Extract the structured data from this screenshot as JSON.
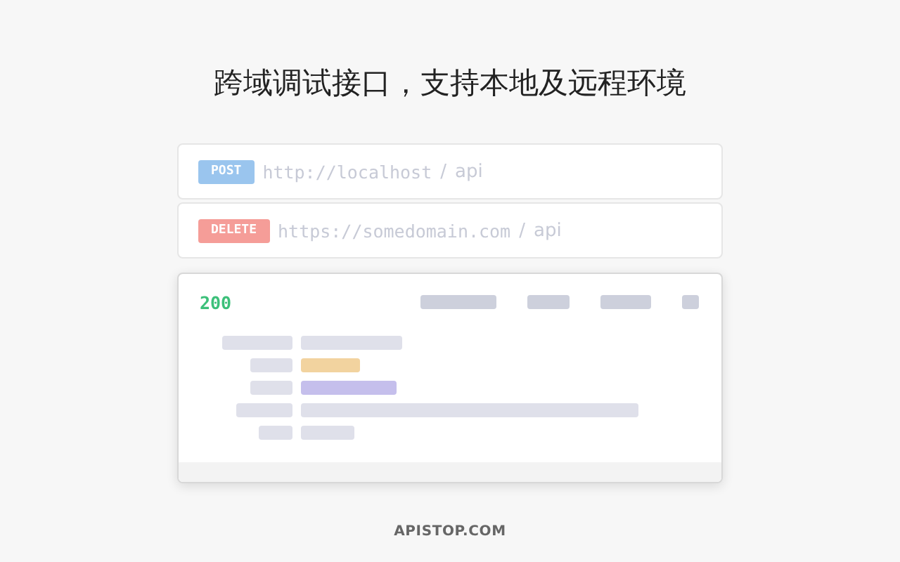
{
  "headline": "跨域调试接口，支持本地及远程环境",
  "requests": [
    {
      "method": "POST",
      "color": "#9ac5ee",
      "host": "http://localhost",
      "separator": "/",
      "path": "api"
    },
    {
      "method": "DELETE",
      "color": "#f59d98",
      "host": "https://somedomain.com",
      "separator": "/",
      "path": "api"
    }
  ],
  "response": {
    "status": "200"
  },
  "footer": "APISTOP.COM"
}
